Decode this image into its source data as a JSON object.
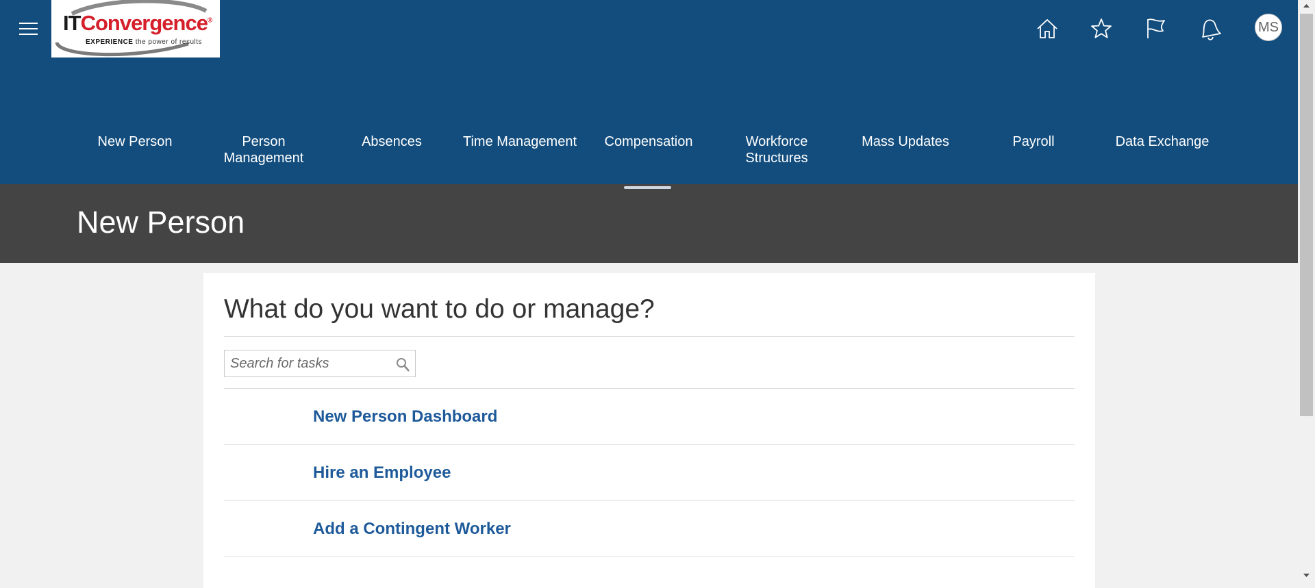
{
  "logo": {
    "name_part1": "IT",
    "name_part2": "Convergence",
    "registered": "®",
    "tagline_bold": "EXPERIENCE",
    "tagline_rest": " the power of results"
  },
  "header": {
    "icons": [
      "home-icon",
      "star-icon",
      "flag-icon",
      "bell-icon"
    ],
    "avatar_initials": "MS",
    "bg_color": "#134d7d"
  },
  "nav": {
    "items": [
      {
        "label": "New Person"
      },
      {
        "label": "Person Management"
      },
      {
        "label": "Absences"
      },
      {
        "label": "Time Management"
      },
      {
        "label": "Compensation"
      },
      {
        "label": "Workforce Structures"
      },
      {
        "label": "Mass Updates"
      },
      {
        "label": "Payroll"
      },
      {
        "label": "Data Exchange"
      }
    ],
    "selected_index": 4
  },
  "page": {
    "title": "New Person",
    "title_bar_color": "#444444"
  },
  "tasks": {
    "heading": "What do you want to do or manage?",
    "search_placeholder": "Search for tasks",
    "search_value": "",
    "items": [
      {
        "label": "New Person Dashboard"
      },
      {
        "label": "Hire an Employee"
      },
      {
        "label": "Add a Contingent Worker"
      }
    ],
    "link_color": "#1e5a9a"
  }
}
